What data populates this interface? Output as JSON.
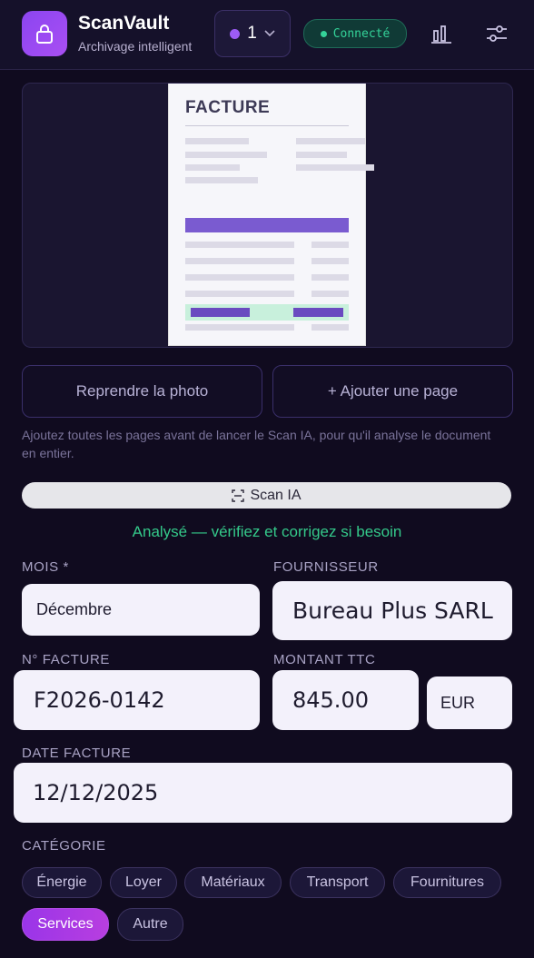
{
  "header": {
    "app_name": "ScanVault",
    "app_subtitle": "Archivage intelligent",
    "page_count": "1",
    "status_label": "Connecté",
    "icons": [
      "lock-icon",
      "chevron-down-icon",
      "chart-icon",
      "settings-sliders-icon"
    ]
  },
  "preview": {
    "doc_title": "FACTURE"
  },
  "actions": {
    "retake_label": "Reprendre la photo",
    "add_page_label": "+ Ajouter une page",
    "hint": "Ajoutez toutes les pages avant de lancer le Scan IA, pour qu'il analyse le document en entier.",
    "scan_label": "Scan IA",
    "analyzed_message": "Analysé — vérifiez et corrigez si besoin"
  },
  "form": {
    "month_label": "MOIS *",
    "month_value": "Décembre",
    "supplier_label": "FOURNISSEUR",
    "supplier_value": "Bureau Plus SARL",
    "invoice_no_label": "N° FACTURE",
    "invoice_no_value": "F2026-0142",
    "amount_label": "MONTANT TTC",
    "amount_value": "845.00",
    "currency_value": "EUR",
    "date_label": "DATE FACTURE",
    "date_value": "12/12/2025",
    "category_label": "CATÉGORIE",
    "categories": [
      "Énergie",
      "Loyer",
      "Matériaux",
      "Transport",
      "Fournitures",
      "Services",
      "Autre"
    ],
    "selected_category": "Services"
  },
  "colors": {
    "accent": "#9a35e8",
    "success": "#34d399",
    "background": "#100b1f"
  }
}
